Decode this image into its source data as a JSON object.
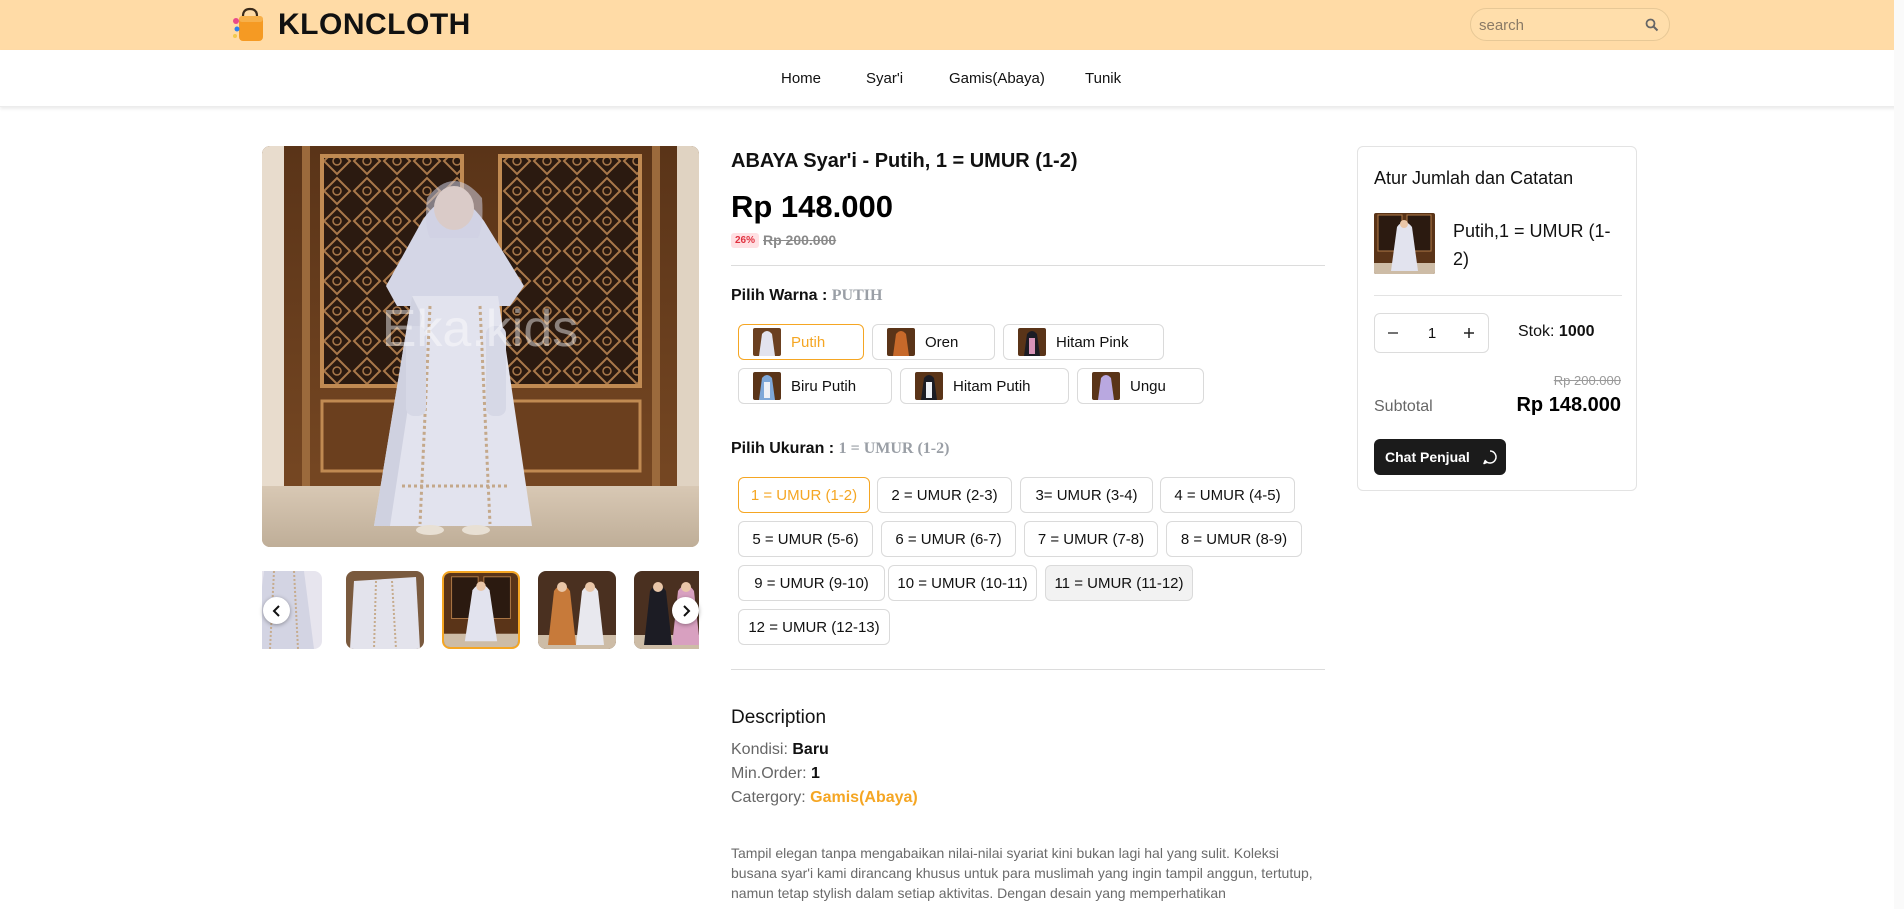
{
  "header": {
    "brand": "KLONCLOTH",
    "search": {
      "placeholder": "search",
      "value": ""
    }
  },
  "nav": {
    "items": [
      "Home",
      "Syar'i",
      "Gamis(Abaya)",
      "Tunik"
    ]
  },
  "gallery": {
    "watermark": "Eka.kids",
    "thumbnails_count": 5,
    "active_index": 2
  },
  "product": {
    "title": "ABAYA Syar'i - Putih, 1 = UMUR (1-2)",
    "price": "Rp 148.000",
    "discount": "26%",
    "old_price": "Rp 200.000",
    "color_label": "Pilih Warna :",
    "color_selected": "PUTIH",
    "colors": [
      "Putih",
      "Oren",
      "Hitam Pink",
      "Biru Putih",
      "Hitam Putih",
      "Ungu"
    ],
    "size_label": "Pilih Ukuran :",
    "size_selected": "1 = UMUR (1-2)",
    "sizes": [
      "1 = UMUR (1-2)",
      "2 = UMUR (2-3)",
      "3= UMUR (3-4)",
      "4 = UMUR (4-5)",
      "5 = UMUR (5-6)",
      "6 = UMUR (6-7)",
      "7 = UMUR (7-8)",
      "8 = UMUR (8-9)",
      "9 = UMUR (9-10)",
      "10 = UMUR (10-11)",
      "11 = UMUR (11-12)",
      "12 = UMUR (12-13)"
    ]
  },
  "description": {
    "heading": "Description",
    "condition_label": "Kondisi:",
    "condition": "Baru",
    "min_order_label": "Min.Order:",
    "min_order": "1",
    "category_label": "Catergory:",
    "category": "Gamis(Abaya)",
    "text": "Tampil elegan tanpa mengabaikan nilai-nilai syariat kini bukan lagi hal yang sulit. Koleksi busana syar'i kami dirancang khusus untuk para muslimah yang ingin tampil anggun, tertutup, namun tetap stylish dalam setiap aktivitas. Dengan desain yang memperhatikan"
  },
  "cart_card": {
    "title": "Atur Jumlah dan Catatan",
    "variant": "Putih,1 = UMUR (1-2)",
    "quantity": "1",
    "stock_label": "Stok:",
    "stock": "1000",
    "old_price": "Rp 200.000",
    "subtotal_label": "Subtotal",
    "subtotal": "Rp 148.000",
    "chat_label": "Chat Penjual"
  },
  "colors": {
    "header_bg": "#ffdba6",
    "accent": "#f5a623",
    "button_dark": "#1b1b1b",
    "discount_red": "#e0313f"
  },
  "icons": [
    "shopping-bag-logo-icon",
    "search-icon",
    "chevron-left-icon",
    "chevron-right-icon",
    "minus-icon",
    "plus-icon",
    "chat-bubble-icon"
  ]
}
